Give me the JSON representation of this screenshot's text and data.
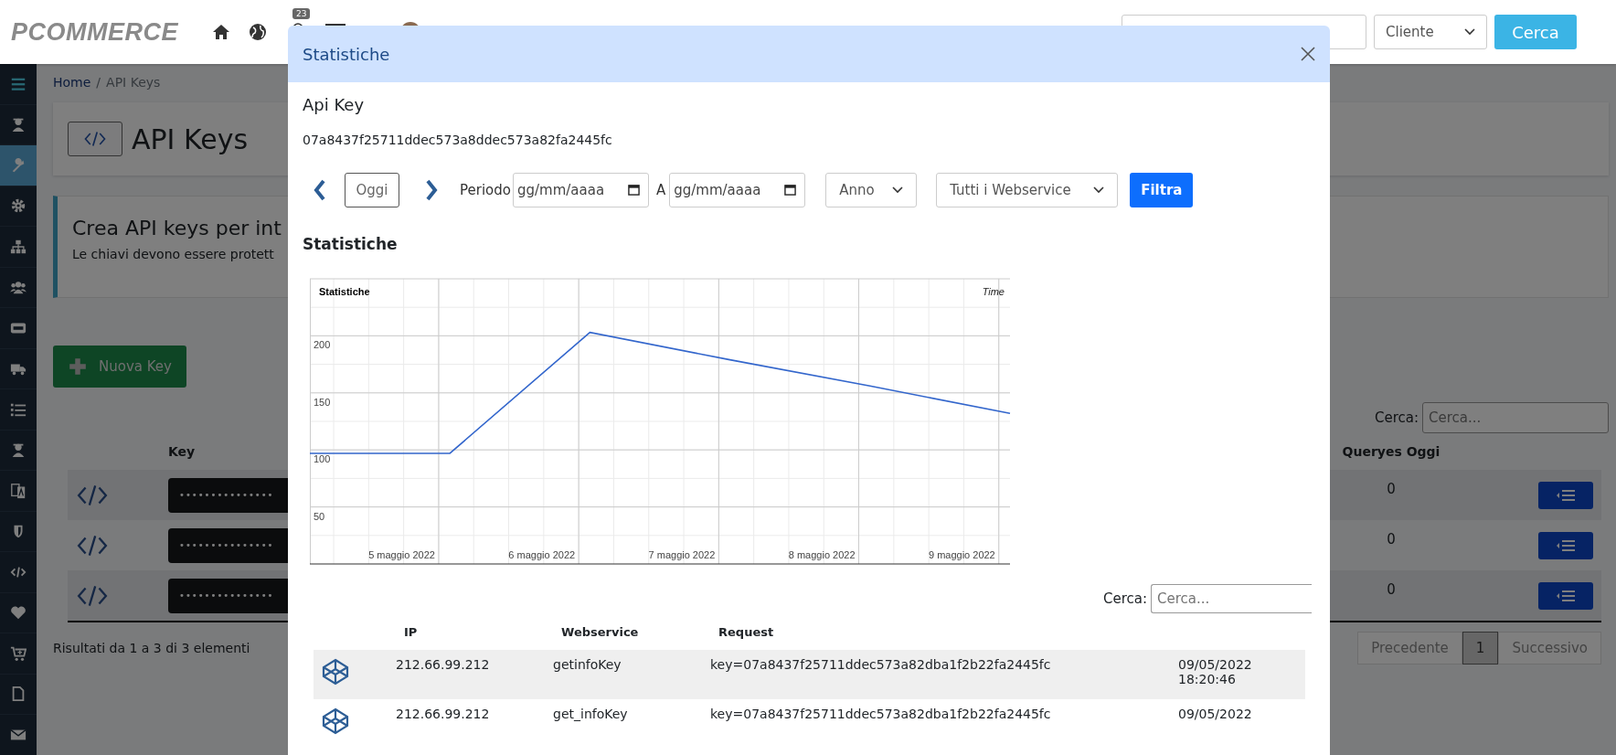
{
  "header": {
    "logo": "PCOMMERCE",
    "notification_badge": "23",
    "customer_select": {
      "value": "Cliente"
    },
    "search_button": "Cerca"
  },
  "sidebar": {
    "items": [
      {
        "selected": false
      },
      {
        "selected": false
      },
      {
        "selected": true
      },
      {
        "selected": false
      },
      {
        "selected": false
      },
      {
        "selected": false
      },
      {
        "selected": false
      },
      {
        "selected": false
      },
      {
        "selected": false
      },
      {
        "selected": false
      },
      {
        "selected": false
      },
      {
        "selected": false
      },
      {
        "selected": false
      },
      {
        "selected": false
      },
      {
        "selected": false
      },
      {
        "selected": false
      },
      {
        "selected": false
      }
    ]
  },
  "page": {
    "breadcrumb": {
      "items": [
        "Home",
        "API Keys"
      ],
      "separator": "/"
    },
    "title": "API Keys",
    "callout": {
      "title": "Crea API keys per int",
      "text": "Le chiavi devono essere protett"
    },
    "new_key_button": "Nuova Key",
    "table": {
      "search_label": "Cerca:",
      "search": {
        "placeholder": "Cerca..."
      },
      "columns": [
        "Key",
        "Queryes Oggi"
      ],
      "rows": [
        {
          "key": "•••••••••••••••",
          "queries_today": "0"
        },
        {
          "key": "•••••••••••••••",
          "queries_today": "0"
        },
        {
          "key": "•••••••••••••••",
          "queries_today": "0"
        }
      ]
    },
    "summary": "Risultati da 1 a 3 di 3 elementi",
    "pagination": [
      {
        "label": "Precedente",
        "selected": false
      },
      {
        "label": "1",
        "selected": true
      },
      {
        "label": "Successivo",
        "selected": false
      }
    ]
  },
  "modal": {
    "title": "Statistiche",
    "api_key_label": "Api Key",
    "api_key": "07a8437f25711ddec573a8ddec573a82fa2445fc",
    "filters": {
      "today_button": "Oggi",
      "period_label": "Periodo",
      "from": {
        "placeholder": "gg/mm/aaaa"
      },
      "to_label": "A",
      "to": {
        "placeholder": "gg/mm/aaaa"
      },
      "period_select": {
        "value": "Anno"
      },
      "webservice_select": {
        "value": "Tutti i Webservice"
      },
      "filter_button": "Filtra"
    },
    "stats_heading": "Statistiche",
    "chart_data": {
      "type": "line",
      "title": "Statistiche",
      "xlabel": "Time",
      "categories": [
        null,
        "5 maggio 2022",
        "6 maggio 2022",
        "7 maggio 2022",
        "8 maggio 2022",
        "9 maggio 2022"
      ],
      "series": [
        {
          "color": "#3366cc",
          "values": [
            97,
            97,
            203,
            179,
            156,
            132
          ]
        }
      ],
      "ylim": [
        0,
        250
      ],
      "grid": true,
      "yticks": [
        50,
        100,
        150,
        200
      ]
    },
    "log_table": {
      "search_label": "Cerca:",
      "search": {
        "placeholder": "Cerca..."
      },
      "columns": [
        "IP",
        "Webservice",
        "Request"
      ],
      "rows": [
        {
          "ip": "212.66.99.212",
          "webservice": "getinfoKey",
          "request": "key=07a8437f25711ddec573a82dba1f2b22fa2445fc",
          "date": "09/05/2022 18:20:46"
        },
        {
          "ip": "212.66.99.212",
          "webservice": "get_infoKey",
          "request": "key=07a8437f25711ddec573a82dba1f2b22fa2445fc",
          "date": "09/05/2022"
        }
      ]
    }
  }
}
